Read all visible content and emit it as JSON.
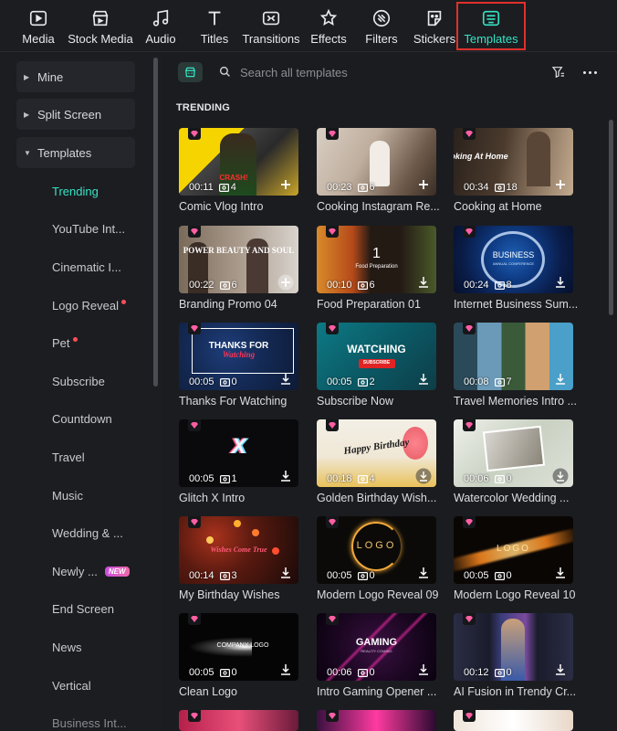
{
  "toolbar": {
    "items": [
      {
        "label": "Media",
        "icon": "media-icon"
      },
      {
        "label": "Stock Media",
        "icon": "stock-media-icon"
      },
      {
        "label": "Audio",
        "icon": "audio-icon"
      },
      {
        "label": "Titles",
        "icon": "titles-icon"
      },
      {
        "label": "Transitions",
        "icon": "transitions-icon"
      },
      {
        "label": "Effects",
        "icon": "effects-icon"
      },
      {
        "label": "Filters",
        "icon": "filters-icon"
      },
      {
        "label": "Stickers",
        "icon": "stickers-icon"
      },
      {
        "label": "Templates",
        "icon": "templates-icon",
        "active": true
      }
    ],
    "accent_color": "#35e3c4",
    "highlight_color": "#e0302b"
  },
  "sidebar": {
    "sections": [
      {
        "label": "Mine",
        "expanded": false
      },
      {
        "label": "Split Screen",
        "expanded": false
      },
      {
        "label": "Templates",
        "expanded": true
      }
    ],
    "items": [
      {
        "label": "Trending",
        "active": true
      },
      {
        "label": "YouTube Int..."
      },
      {
        "label": "Cinematic I..."
      },
      {
        "label": "Logo Reveal",
        "dot": true
      },
      {
        "label": "Pet",
        "dot": true
      },
      {
        "label": "Subscribe"
      },
      {
        "label": "Countdown"
      },
      {
        "label": "Travel"
      },
      {
        "label": "Music"
      },
      {
        "label": "Wedding & ..."
      },
      {
        "label": "Newly ...",
        "badge": "NEW"
      },
      {
        "label": "End Screen"
      },
      {
        "label": "News"
      },
      {
        "label": "Vertical"
      },
      {
        "label": "Business Int..."
      }
    ]
  },
  "search": {
    "placeholder": "Search all templates",
    "value": ""
  },
  "main": {
    "section_title": "TRENDING",
    "templates": [
      {
        "title": "Comic Vlog Intro",
        "duration": "00:11",
        "clips": "4",
        "action": "add"
      },
      {
        "title": "Cooking Instagram Re...",
        "duration": "00:23",
        "clips": "6",
        "action": "add"
      },
      {
        "title": "Cooking at Home",
        "duration": "00:34",
        "clips": "18",
        "action": "add"
      },
      {
        "title": "Branding Promo 04",
        "duration": "00:22",
        "clips": "6",
        "action": "add"
      },
      {
        "title": "Food Preparation 01",
        "duration": "00:10",
        "clips": "6",
        "action": "download"
      },
      {
        "title": "Internet Business Sum...",
        "duration": "00:24",
        "clips": "8",
        "action": "download"
      },
      {
        "title": "Thanks For Watching",
        "duration": "00:05",
        "clips": "0",
        "action": "download"
      },
      {
        "title": "Subscribe Now",
        "duration": "00:05",
        "clips": "2",
        "action": "download"
      },
      {
        "title": "Travel Memories Intro ...",
        "duration": "00:08",
        "clips": "7",
        "action": "download"
      },
      {
        "title": "Glitch X Intro",
        "duration": "00:05",
        "clips": "1",
        "action": "download"
      },
      {
        "title": "Golden Birthday Wish...",
        "duration": "00:18",
        "clips": "4",
        "action": "download"
      },
      {
        "title": "Watercolor Wedding ...",
        "duration": "00:06",
        "clips": "0",
        "action": "download"
      },
      {
        "title": "My Birthday Wishes",
        "duration": "00:14",
        "clips": "3",
        "action": "download"
      },
      {
        "title": "Modern Logo Reveal 09",
        "duration": "00:05",
        "clips": "0",
        "action": "download"
      },
      {
        "title": "Modern Logo Reveal 10",
        "duration": "00:05",
        "clips": "0",
        "action": "download"
      },
      {
        "title": "Clean Logo",
        "duration": "00:05",
        "clips": "0",
        "action": "download"
      },
      {
        "title": "Intro Gaming Opener ...",
        "duration": "00:06",
        "clips": "0",
        "action": "download"
      },
      {
        "title": "AI Fusion in Trendy Cr...",
        "duration": "00:12",
        "clips": "0",
        "action": "download"
      }
    ],
    "thumb_texts": {
      "comic": "CRASH!",
      "cooking_home": "Cooking At Home",
      "branding": "POWER BEAUTY AND SOUL",
      "food_num": "1",
      "food_sub": "Food Preparation",
      "business": "BUSINESS",
      "business_sub": "ANNUAL CONFERENCE",
      "thanks": "THANKS FOR",
      "thanks_script": "Watching",
      "watching": "WATCHING",
      "subscribe_btn": "SUBSCRIBE",
      "glitch": "X",
      "birthday": "Happy Birthday",
      "wishes": "Wishes Come True",
      "logo9": "LOGO",
      "logo10": "LOGO",
      "clean_logo": "COMPANY LOGO",
      "gaming": "GAMING",
      "gaming_sub": "REALITY COMING"
    }
  }
}
